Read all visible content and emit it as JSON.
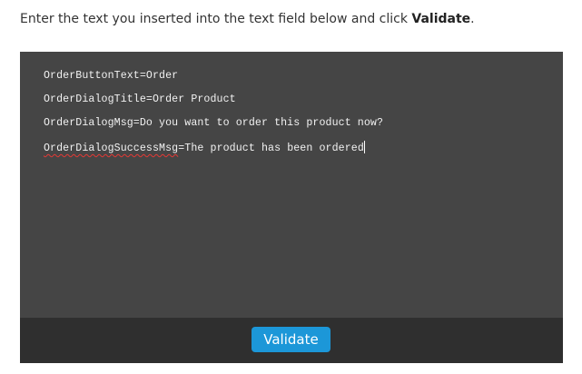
{
  "instruction": {
    "text_before": "Enter the text you inserted into the text field below and click ",
    "action_word": "Validate",
    "text_after": "."
  },
  "editor": {
    "lines": [
      "OrderButtonText=Order",
      "OrderDialogTitle=Order Product",
      "OrderDialogMsg=Do you want to order this product now?"
    ],
    "last_line_key": "OrderDialogSuccessMsg",
    "last_line_rest": "=The product has been ordered"
  },
  "footer": {
    "validate_label": "Validate"
  },
  "colors": {
    "panel_bg": "#454545",
    "footer_bg": "#2f2f2f",
    "button_accent": "#1c97d8",
    "spellcheck_underline": "#e53935"
  }
}
